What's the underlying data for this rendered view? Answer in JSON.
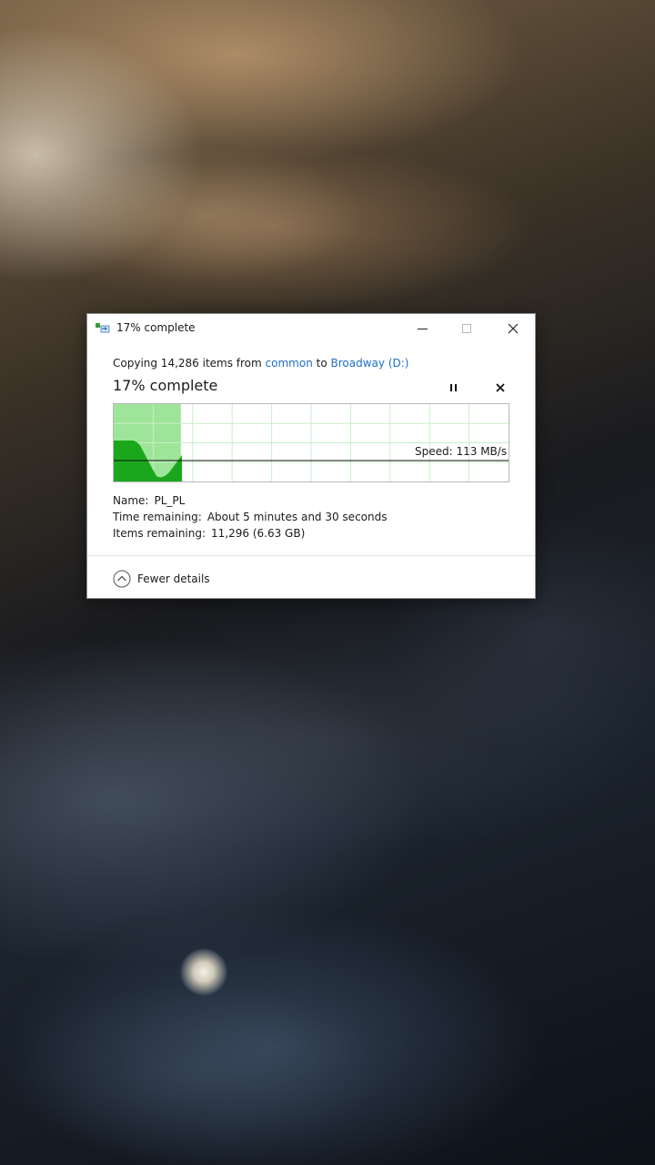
{
  "dialog": {
    "title": "17% complete",
    "copy_prefix": "Copying 14,286 items from",
    "source": "common",
    "to_word": "to",
    "destination": "Broadway (D:)",
    "progress_heading": "17% complete",
    "progress_fraction": 0.17,
    "speed": "Speed: 113 MB/s",
    "details": {
      "name_label": "Name:",
      "name_value": "PL_PL",
      "time_label": "Time remaining:",
      "time_value": "About 5 minutes and 30 seconds",
      "items_label": "Items remaining:",
      "items_value": "11,296 (6.63 GB)"
    },
    "fewer_details": "Fewer details"
  },
  "colors": {
    "progress_fill": "#9ee59a",
    "speed_fill": "#1ba71b",
    "grid": "#c9eec6",
    "link": "#1f6fc5"
  },
  "icons": [
    "copy-icon",
    "minimize-icon",
    "maximize-icon",
    "close-icon",
    "pause-icon",
    "cancel-icon",
    "chevron-up-icon"
  ]
}
